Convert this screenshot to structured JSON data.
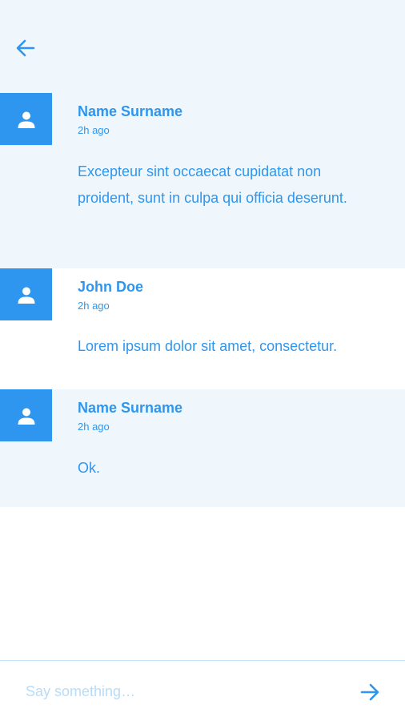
{
  "header": {
    "back_icon": "arrow-left-icon"
  },
  "messages": [
    {
      "author": "Name Surname",
      "time": "2h ago",
      "text": "Excepteur sint occaecat cupidatat non proident, sunt in culpa qui officia deserunt."
    },
    {
      "author": "John Doe",
      "time": "2h ago",
      "text": "Lorem ipsum dolor sit amet, consectetur."
    },
    {
      "author": "Name Surname",
      "time": "2h ago",
      "text": "Ok."
    }
  ],
  "composer": {
    "placeholder": "Say something…",
    "value": "",
    "send_icon": "arrow-right-icon"
  },
  "colors": {
    "accent": "#2e96ee",
    "shaded_bg": "#eff7fd",
    "placeholder": "#b8dcf7",
    "divider": "#c4e2f8"
  }
}
